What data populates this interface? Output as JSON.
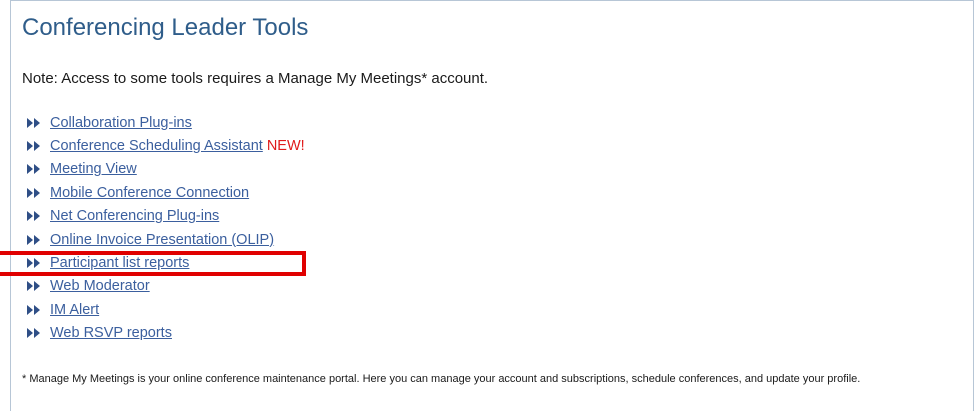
{
  "page": {
    "title": "Conferencing Leader Tools",
    "note": "Note: Access to some tools requires a Manage My Meetings* account.",
    "footnote": "* Manage My Meetings is your online conference maintenance portal. Here you can manage your account and subscriptions, schedule conferences, and update your profile."
  },
  "tools": [
    {
      "label": "Collaboration Plug-ins"
    },
    {
      "label": "Conference Scheduling Assistant",
      "badge": "NEW!"
    },
    {
      "label": "Meeting View"
    },
    {
      "label": "Mobile Conference Connection"
    },
    {
      "label": "Net Conferencing Plug-ins"
    },
    {
      "label": "Online Invoice Presentation (OLIP)"
    },
    {
      "label": "Participant list reports",
      "highlighted": true
    },
    {
      "label": "Web Moderator"
    },
    {
      "label": "IM Alert"
    },
    {
      "label": "Web RSVP reports"
    }
  ],
  "colors": {
    "title": "#2f5d8a",
    "link": "#3b5f9e",
    "badge": "#e01b1b",
    "highlight": "#e00000",
    "arrow": "#2f4f86"
  },
  "icons": {
    "bullet": "double-arrow-right-icon"
  }
}
